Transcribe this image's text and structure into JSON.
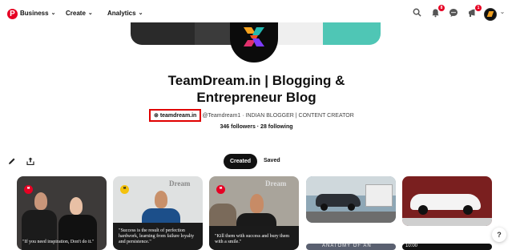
{
  "nav": {
    "items": [
      {
        "label": "Business"
      },
      {
        "label": "Create"
      },
      {
        "label": "Analytics"
      }
    ],
    "notifications_badge": "8",
    "messages_badge": "1"
  },
  "profile": {
    "title_line1": "TeamDream.in | Blogging &",
    "title_line2": "Entrepreneur Blog",
    "website": "teamdream.in",
    "handle_desc": "@Teamdream1 · INDIAN BLOGGER | CONTENT CREATOR",
    "follow_stats": "346 followers · 28 following"
  },
  "tabs": {
    "created": "Created",
    "saved": "Saved"
  },
  "pins": [
    {
      "quote": "\"If you need inspiration, Don't do it.\""
    },
    {
      "quote": "\"Success is the result of perfection hardwork, learning from failure loyalty and persistence.\""
    },
    {
      "quote": "\"Kill them with success and bury them with a smile.\""
    },
    {
      "quote": ""
    },
    {
      "quote": ""
    }
  ],
  "pin_brand": "Dream",
  "partial_pin_text": "ANATOMY OF AN",
  "partial_pin_time": "10:00",
  "colors": {
    "accent": "#e60023",
    "highlight_box": "#e00000"
  }
}
